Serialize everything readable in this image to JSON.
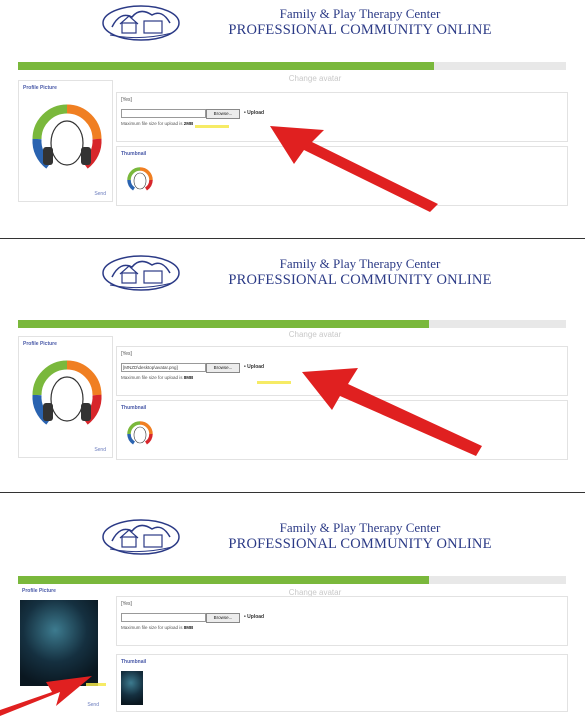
{
  "header": {
    "title_line1": "Family & Play Therapy Center",
    "title_line2": "PROFESSIONAL COMMUNITY ONLINE"
  },
  "progress": {
    "fraction": 0.76,
    "color": "#7ab83c"
  },
  "change_avatar_label": "Change avatar",
  "profile_picture_label": "Profile Picture",
  "send_label": "Send",
  "thumbnail_label": "Thumbnail",
  "file_label": "[Yes]",
  "browse_label": "Browse...",
  "upload_label": "• Upload",
  "panels": [
    {
      "file_value": "",
      "max_size_text": "Maximum file size for upload is",
      "max_size_value": "2MB"
    },
    {
      "file_value": "[MNZD\\desktop\\avatar.png]",
      "max_size_text": "Maximum file size for upload is",
      "max_size_value": "8MB"
    },
    {
      "file_value": "",
      "max_size_text": "Maximum file size for upload is",
      "max_size_value": "8MB"
    }
  ],
  "colors": {
    "brand_blue": "#2b3a86",
    "progress_green": "#7ab83c",
    "arrow_red": "#e02020",
    "highlight_yellow": "#f5e84a"
  }
}
